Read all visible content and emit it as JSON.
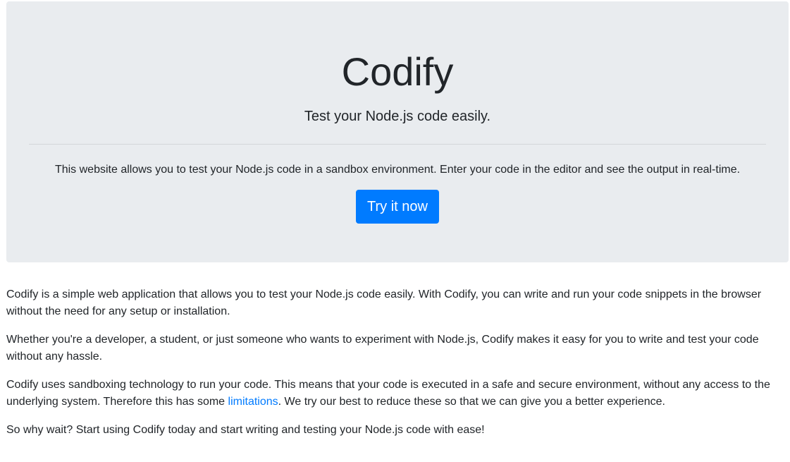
{
  "hero": {
    "title": "Codify",
    "lead": "Test your Node.js code easily.",
    "description": "This website allows you to test your Node.js code in a sandbox environment. Enter your code in the editor and see the output in real-time.",
    "cta_label": "Try it now"
  },
  "content": {
    "paragraph1": "Codify is a simple web application that allows you to test your Node.js code easily. With Codify, you can write and run your code snippets in the browser without the need for any setup or installation.",
    "paragraph2": "Whether you're a developer, a student, or just someone who wants to experiment with Node.js, Codify makes it easy for you to write and test your code without any hassle.",
    "paragraph3_before": "Codify uses sandboxing technology to run your code. This means that your code is executed in a safe and secure environment, without any access to the underlying system. Therefore this has some ",
    "paragraph3_link": "limitations",
    "paragraph3_after": ". We try our best to reduce these so that we can give you a better experience.",
    "paragraph4": "So why wait? Start using Codify today and start writing and testing your Node.js code with ease!"
  },
  "colors": {
    "accent": "#007bff",
    "hero_background": "#e9ecef",
    "text": "#212529"
  }
}
